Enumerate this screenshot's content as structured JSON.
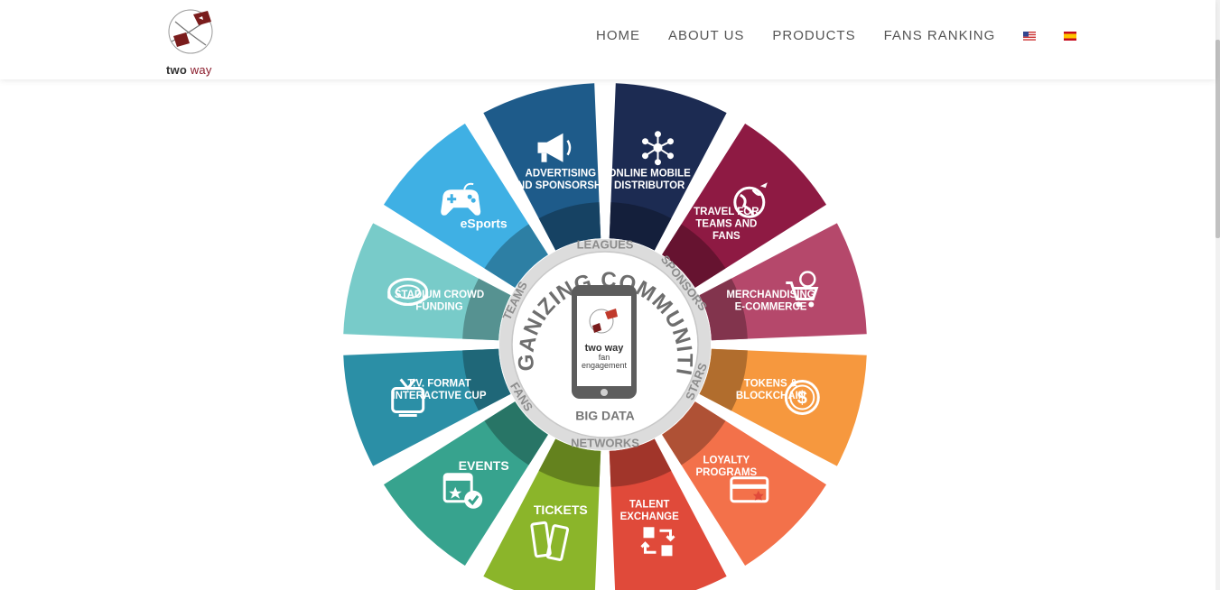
{
  "brand": {
    "name_part1": "two",
    "name_part2": "way"
  },
  "nav": {
    "items": [
      "HOME",
      "ABOUT US",
      "PRODUCTS",
      "FANS RANKING"
    ],
    "flags": [
      "english-flag",
      "spanish-flag"
    ]
  },
  "wheel": {
    "center_title": "ORGANIZING COMMUNITIES",
    "center_brand": "two way",
    "center_sub1": "fan",
    "center_sub2": "engagement",
    "ring_words": [
      "LEAGUES",
      "SPONSORS",
      "STARS",
      "NETWORKS",
      "BIG DATA",
      "FANS",
      "TEAMS"
    ],
    "segments": [
      {
        "line1": "ONLINE MOBILE",
        "line2": "DISTRIBUTOR",
        "line3": "",
        "color": "#1c2b52",
        "icon": "network-icon"
      },
      {
        "line1": "TRAVEL FOR",
        "line2": "TEAMS AND",
        "line3": "FANS",
        "color": "#8e1a43",
        "icon": "globe-plane-icon"
      },
      {
        "line1": "MERCHANDISING",
        "line2": "E-COMMERCE",
        "line3": "",
        "color": "#b5486b",
        "icon": "shopping-cart-icon"
      },
      {
        "line1": "TOKENS &",
        "line2": "BLOCKCHAIN",
        "line3": "",
        "color": "#f6983e",
        "icon": "coin-icon"
      },
      {
        "line1": "LOYALTY",
        "line2": "PROGRAMS",
        "line3": "",
        "color": "#f3714a",
        "icon": "card-icon"
      },
      {
        "line1": "TALENT",
        "line2": "EXCHANGE",
        "line3": "",
        "color": "#e04a3a",
        "icon": "exchange-icon"
      },
      {
        "line1": "TICKETS",
        "line2": "",
        "line3": "",
        "color": "#8bb52a",
        "icon": "ticket-icon"
      },
      {
        "line1": "EVENTS",
        "line2": "",
        "line3": "",
        "color": "#37a38e",
        "icon": "calendar-icon"
      },
      {
        "line1": "T.V. FORMAT",
        "line2": "INTERACTIVE CUP",
        "line3": "",
        "color": "#2b8fa6",
        "icon": "tv-icon"
      },
      {
        "line1": "STADIUM CROWD",
        "line2": "FUNDING",
        "line3": "",
        "color": "#78cbc9",
        "icon": "stadium-icon"
      },
      {
        "line1": "eSports",
        "line2": "",
        "line3": "",
        "color": "#3fb0e4",
        "icon": "gamepad-icon"
      },
      {
        "line1": "ADVERTISING",
        "line2": "AND SPONSORSHIP",
        "line3": "",
        "color": "#1e5b8a",
        "icon": "megaphone-icon"
      }
    ]
  }
}
